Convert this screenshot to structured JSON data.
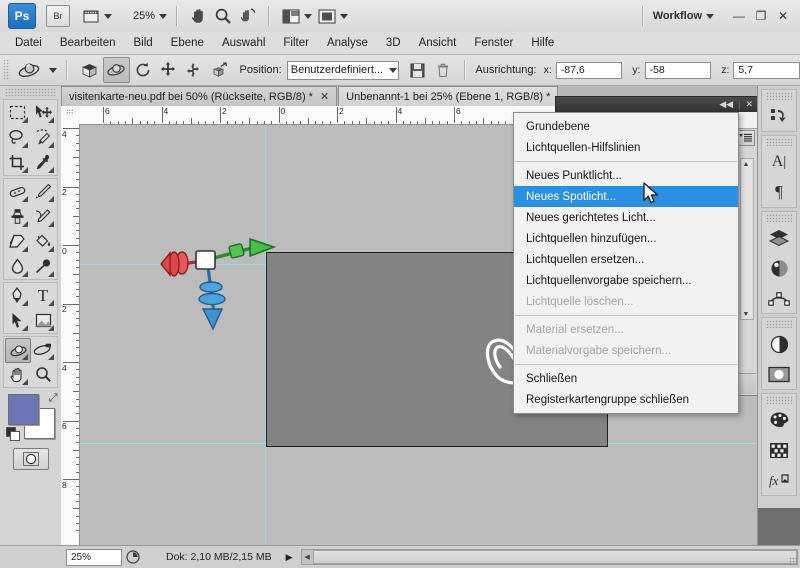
{
  "app": {
    "logo": "Ps",
    "bridge_label": "Br",
    "zoom_level": "25%",
    "workspace_label": "Workflow",
    "minimize": "—",
    "restore": "❐",
    "close": "✕",
    "icons": {
      "bridge": "bridge-icon",
      "view_extras": "view-extras-icon",
      "hand": "hand-icon",
      "zoom": "zoom-icon",
      "rotate_view": "rotate-view-icon",
      "screen_mode": "screen-mode-icon",
      "arrange": "arrange-documents-icon"
    }
  },
  "menubar": {
    "items": [
      "Datei",
      "Bearbeiten",
      "Bild",
      "Ebene",
      "Auswahl",
      "Filter",
      "Analyse",
      "3D",
      "Ansicht",
      "Fenster",
      "Hilfe"
    ]
  },
  "options_bar": {
    "position_label": "Position:",
    "position_value": "Benutzerdefiniert...",
    "orientation_label": "Ausrichtung:",
    "x_label": "x:",
    "x_value": "-87,6",
    "y_label": "y:",
    "y_value": "-58",
    "z_label": "z:",
    "z_value": "5,7",
    "save_icon": "save-icon",
    "delete_icon": "trash-icon",
    "mode_icons": [
      "3d-object-cube-icon",
      "3d-orbit-icon",
      "3d-roll-icon",
      "3d-pan-icon",
      "3d-slide-icon",
      "3d-scale-icon"
    ]
  },
  "toolbox": {
    "groups": [
      [
        "marquee-tool",
        "move-tool",
        "lasso-tool",
        "quick-selection-tool",
        "crop-tool",
        "eyedropper-tool"
      ],
      [
        "healing-brush-tool",
        "brush-tool",
        "clone-stamp-tool",
        "history-brush-tool",
        "eraser-tool",
        "gradient-tool",
        "blur-tool",
        "dodge-tool"
      ],
      [
        "pen-tool",
        "type-tool",
        "path-selection-tool",
        "shape-tool"
      ],
      [
        "3d-orbit-tool",
        "3d-camera-tool",
        "hand-tool",
        "zoom-tool"
      ]
    ],
    "foreground_color": "#6c76b5",
    "background_color": "#ffffff",
    "swap_icon": "swap-colors-icon",
    "default_icon": "default-colors-icon",
    "quickmask_icon": "quick-mask-icon"
  },
  "tabs": [
    {
      "title": "visitenkarte-neu.pdf bei 50% (Rückseite, RGB/8) *",
      "active": false,
      "closable": true
    },
    {
      "title": "Unbenannt-1 bei 25% (Ebene 1, RGB/8) *",
      "active": true,
      "closable": false
    }
  ],
  "canvas": {
    "ruler_h_labels": [
      "6",
      "4",
      "2",
      "0",
      "2",
      "4",
      "6"
    ],
    "ruler_v_labels": [
      "4",
      "2",
      "0",
      "2",
      "4",
      "6",
      "8"
    ],
    "axis_widget": {
      "x_axis_color": "#e04a4a",
      "y_axis_color": "#3fb03f",
      "z_axis_color": "#3b8fd1",
      "center_color": "#ffffff",
      "name": "3d-axis-widget"
    },
    "artboard_color": "#838383",
    "butterfly": "butterfly-shape"
  },
  "panel": {
    "collapse_icon": "◀◀",
    "close_icon": "✕",
    "menu_icon": "panel-menu-icon",
    "footer_icons": [
      "toggle-layers-icon",
      "toggle-lights-icon",
      "new-layer-icon",
      "delete-layer-icon"
    ]
  },
  "context_menu": {
    "items": [
      {
        "label": "Grundebene",
        "state": "normal"
      },
      {
        "label": "Lichtquellen-Hilfslinien",
        "state": "normal"
      },
      {
        "separator": true
      },
      {
        "label": "Neues Punktlicht...",
        "state": "normal"
      },
      {
        "label": "Neues Spotlicht...",
        "state": "highlighted"
      },
      {
        "label": "Neues gerichtetes Licht...",
        "state": "normal"
      },
      {
        "label": "Lichtquellen hinzufügen...",
        "state": "normal"
      },
      {
        "label": "Lichtquellen ersetzen...",
        "state": "normal"
      },
      {
        "label": "Lichtquellenvorgabe speichern...",
        "state": "normal"
      },
      {
        "label": "Lichtquelle löschen...",
        "state": "disabled"
      },
      {
        "separator": true
      },
      {
        "label": "Material ersetzen...",
        "state": "disabled"
      },
      {
        "label": "Materialvorgabe speichern...",
        "state": "disabled"
      },
      {
        "separator": true
      },
      {
        "label": "Schließen",
        "state": "normal"
      },
      {
        "label": "Registerkartengruppe schließen",
        "state": "normal"
      }
    ],
    "highlight_color": "#2a8fe0"
  },
  "dock": {
    "groups": [
      [
        "history-icon"
      ],
      [
        "character-icon",
        "paragraph-icon"
      ],
      [
        "layers-icon",
        "3d-icon",
        "paths-icon"
      ],
      [
        "adjustments-icon",
        "masks-icon"
      ],
      [
        "color-swatches-icon",
        "swatches-grid-icon",
        "styles-fx-icon"
      ]
    ]
  },
  "statusbar": {
    "zoom": "25%",
    "clock_icon": "timing-icon",
    "doc_info": "Dok: 2,10 MB/2,15 MB",
    "expand_arrow": "▶"
  }
}
